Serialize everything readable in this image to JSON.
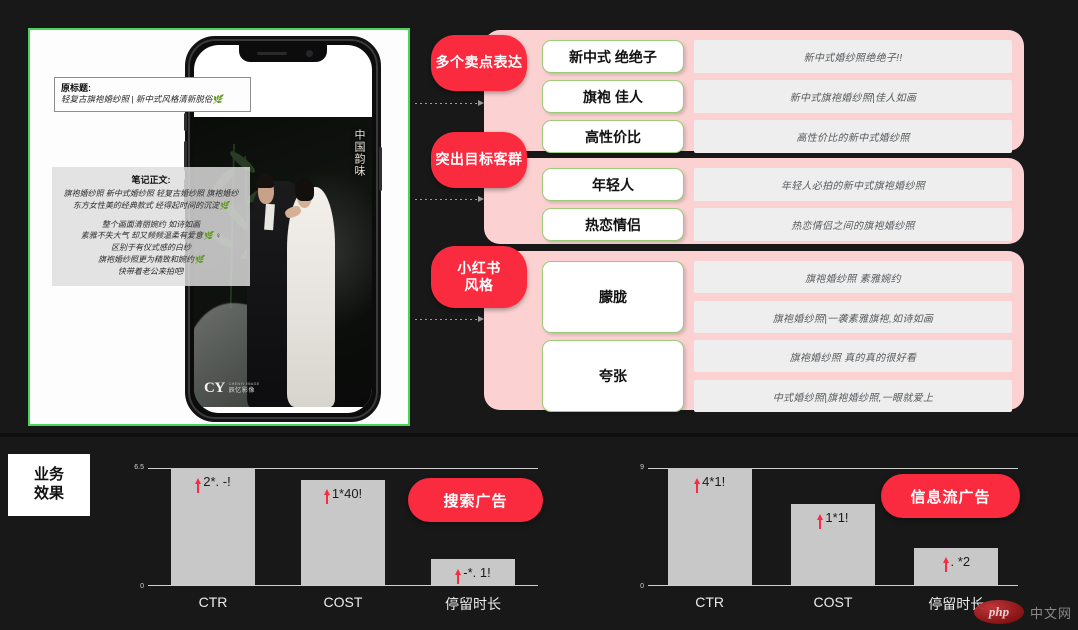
{
  "phone_panel": {
    "title_box": {
      "label": "原标题:",
      "value": "轻复古旗袍婚纱照 | 新中式风格清新脱俗🌿"
    },
    "body_box": {
      "label": "笔记正文:",
      "lines": [
        "旗袍婚纱照 新中式婚纱照 轻复古婚纱照 旗袍婚纱",
        "东方女性美的经典款式 经得起时间的沉淀🌿",
        "",
        "整个画面清丽婉约 如诗如画",
        "素雅不失大气 却又频频温柔有爱意🌿 ♀",
        "区别于有仪式感的白纱",
        "旗袍婚纱照更为精致和婉约🌿",
        "快带着老公来拍吧!"
      ]
    },
    "photo": {
      "vertical_caption": "中国韵味",
      "brand_mark": "CY",
      "brand_en": "CHENYI IMAGE",
      "brand_cn": "辰忆影像"
    }
  },
  "groups": [
    {
      "pill": "多个卖点表达",
      "rows": [
        {
          "key": "新中式 绝绝子",
          "values": [
            "新中式婚纱照绝绝子!!"
          ]
        },
        {
          "key": "旗袍 佳人",
          "values": [
            "新中式旗袍婚纱照|佳人如画"
          ]
        },
        {
          "key": "高性价比",
          "values": [
            "高性价比的新中式婚纱照"
          ]
        }
      ]
    },
    {
      "pill": "突出目标客群",
      "rows": [
        {
          "key": "年轻人",
          "values": [
            "年轻人必拍的新中式旗袍婚纱照"
          ]
        },
        {
          "key": "热恋情侣",
          "values": [
            "热恋情侣之间的旗袍婚纱照"
          ]
        }
      ]
    },
    {
      "pill": "小红书\n风格",
      "pill_line1": "小红书",
      "pill_line2": "风格",
      "rows": [
        {
          "key": "朦胧",
          "values": [
            "旗袍婚纱照  素雅婉约",
            "旗袍婚纱照|一袭素雅旗袍,如诗如画"
          ]
        },
        {
          "key": "夸张",
          "values": [
            "旗袍婚纱照  真的真的很好看",
            "中式婚纱照|旗袍婚纱照,一眼就爱上"
          ]
        }
      ]
    }
  ],
  "bottom": {
    "badge_line1": "业务",
    "badge_line2": "效果",
    "watermark_logo": "php",
    "watermark_text": "中文网"
  },
  "chart_data": [
    {
      "type": "bar",
      "title": "搜索广告",
      "categories": [
        "CTR",
        "COST",
        "停留时长"
      ],
      "values": [
        6.5,
        5.9,
        1.0
      ],
      "value_labels": [
        "2*. -!",
        "1*40!",
        "-*. 1!"
      ],
      "ylim": [
        0,
        6.5
      ],
      "ytick_labels": [
        "6.5",
        "0"
      ],
      "xlabel": "",
      "ylabel": "",
      "grid": false,
      "legend": "none"
    },
    {
      "type": "bar",
      "title": "信息流广告",
      "categories": [
        "CTR",
        "COST",
        "停留时长"
      ],
      "values": [
        9.0,
        6.2,
        2.9
      ],
      "value_labels": [
        "4*1!",
        "1*1!",
        ". *2"
      ],
      "ylim": [
        0,
        9
      ],
      "ytick_labels": [
        "9",
        "0"
      ],
      "xlabel": "",
      "ylabel": "",
      "grid": false,
      "legend": "none"
    }
  ],
  "colors": {
    "accent_red": "#fa2b3f",
    "panel_pink": "#fbd1d1",
    "chip_gray": "#eeeeee",
    "key_border_green": "#9ccc7a",
    "bar_gray": "#c8c8c8",
    "background": "#181818"
  }
}
